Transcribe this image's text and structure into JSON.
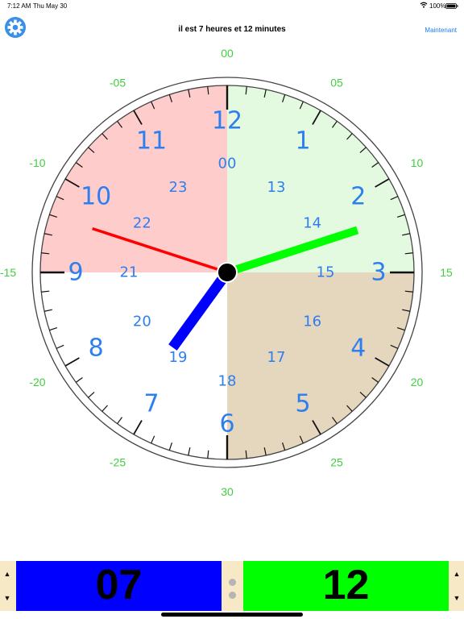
{
  "status_bar": {
    "time": "7:12 AM",
    "date": "Thu May 30",
    "battery_percent": "100%",
    "wifi_icon": "wifi-icon",
    "battery_icon": "battery-icon"
  },
  "header": {
    "title": "il est 7 heures et 12 minutes",
    "now_label": "Maintenant",
    "settings_icon": "gear-icon"
  },
  "clock": {
    "hour": 7,
    "minute": 12,
    "hour_numbers": [
      "12",
      "1",
      "2",
      "3",
      "4",
      "5",
      "6",
      "7",
      "8",
      "9",
      "10",
      "11"
    ],
    "hour_24_numbers": [
      "00",
      "13",
      "14",
      "15",
      "16",
      "17",
      "18",
      "19",
      "20",
      "21",
      "22",
      "23"
    ],
    "minute_labels": [
      "00",
      "05",
      "10",
      "15",
      "20",
      "25",
      "30",
      "-25",
      "-20",
      "-15",
      "-10",
      "-05"
    ],
    "colors": {
      "quadrant_top_right": "#e4fae0",
      "quadrant_bottom_right": "#e5d6be",
      "quadrant_top_left": "#ffcccc",
      "quadrant_bottom_left": "#ffffff",
      "hour_numbers": "#2d7ff0",
      "minute_labels": "#3fcf3f",
      "hour_hand": "#0000ff",
      "minute_hand": "#00ff00",
      "second_hand": "#ff0000"
    },
    "second_hand_minute_position": 48
  },
  "bottom_bar": {
    "hour_display": "07",
    "minute_display": "12",
    "up_arrow": "▲",
    "down_arrow": "▼"
  }
}
